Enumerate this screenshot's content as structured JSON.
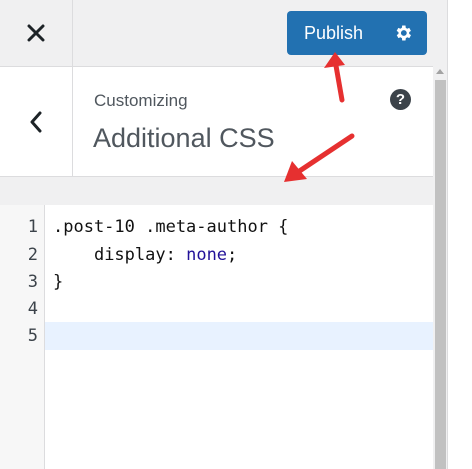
{
  "header": {
    "close_icon": "close-icon",
    "publish_label": "Publish",
    "settings_icon": "gear-icon",
    "accent": "#2271b1"
  },
  "section": {
    "breadcrumb": "Customizing",
    "title": "Additional CSS",
    "back_icon": "chevron-left-icon",
    "help_icon": "help-icon",
    "help_glyph": "?"
  },
  "editor": {
    "line_numbers": [
      "1",
      "2",
      "3",
      "4",
      "5"
    ],
    "lines": [
      {
        "selector": ".post-10 .meta-author",
        "brace": " {"
      },
      {
        "indent": "    ",
        "property": "display",
        "colon": ": ",
        "value": "none",
        "end": ";"
      },
      {
        "text": "}"
      },
      {
        "text": ""
      },
      {
        "text": ""
      }
    ],
    "active_line": 5
  },
  "annotations": {
    "arrow_color": "#e63030"
  }
}
